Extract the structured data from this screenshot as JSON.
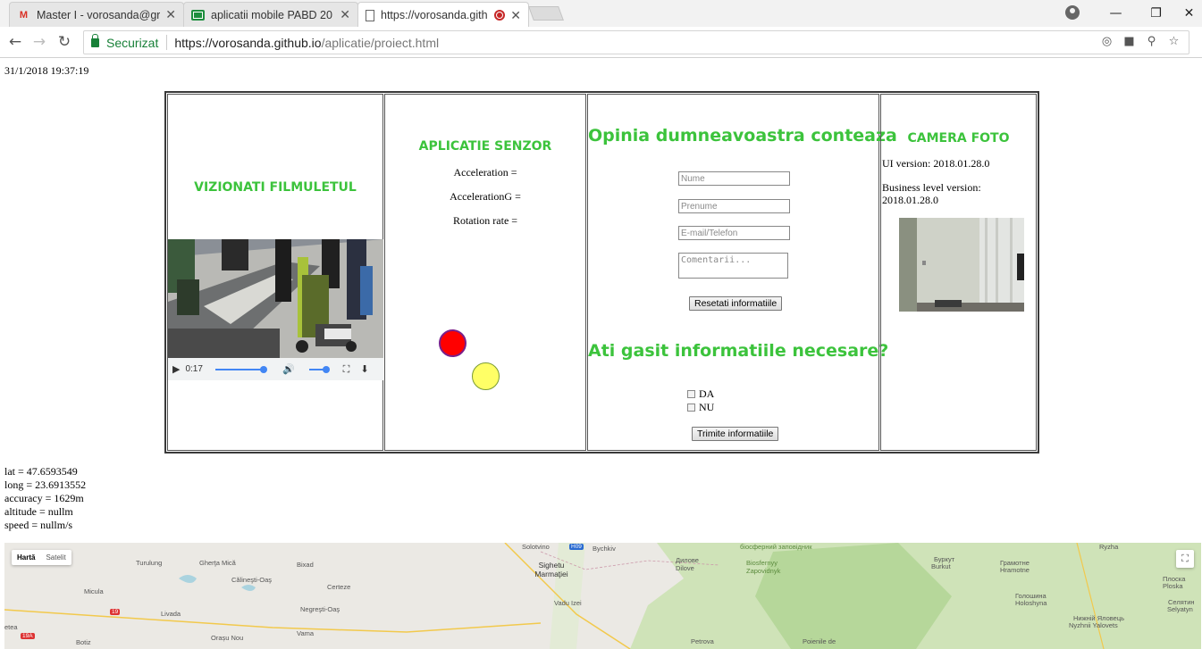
{
  "browser": {
    "tabs": [
      {
        "title": "Master I - vorosanda@gr",
        "icon": "gmail-icon"
      },
      {
        "title": "aplicatii mobile PABD 20",
        "icon": "sheets-icon"
      },
      {
        "title": "https://vorosanda.gith",
        "icon": "page-icon",
        "active": true
      }
    ],
    "close_glyph": "✕",
    "secure_label": "Securizat",
    "url_host": "https://vorosanda.github.io",
    "url_path": "/aplicatie/proiect.html"
  },
  "page": {
    "datetime": "31/1/2018 19:37:19",
    "video_section": {
      "title": "VIZIONATI FILMULETUL",
      "time": "0:17",
      "progress_fraction": 1.0,
      "volume_fraction": 0.85
    },
    "sensor_section": {
      "title": "APLICATIE SENZOR",
      "acceleration": "Acceleration =",
      "acceleration_g": "AccelerationG =",
      "rotation_rate": "Rotation rate ="
    },
    "feedback_section": {
      "title": "Opinia dumneavoastra conteaza",
      "name_placeholder": "Nume",
      "surname_placeholder": "Prenume",
      "contact_placeholder": "E-mail/Telefon",
      "comments_placeholder": "Comentarii...",
      "reset_label": "Resetati informatiile",
      "question": "Ati gasit informatiile necesare?",
      "yes_label": "DA",
      "no_label": "NU",
      "submit_label": "Trimite informatiile"
    },
    "camera_section": {
      "title": "CAMERA FOTO",
      "ui_version": "UI version: 2018.01.28.0",
      "business_version_label": "Business level version:",
      "business_version_value": "2018.01.28.0"
    },
    "geolocation": {
      "lat": "lat = 47.6593549",
      "long": "long = 23.6913552",
      "accuracy": "accuracy = 1629m",
      "altitude": "altitude = nullm",
      "speed": "speed = nullm/s"
    },
    "map": {
      "map_label": "Hartă",
      "satellite_label": "Satelit",
      "places": [
        "Turulung",
        "Gherţa Mică",
        "Bixad",
        "Micula",
        "Călineşti-Oaş",
        "Certeze",
        "Livada",
        "Negreşti-Oaş",
        "Botiz",
        "Orașu Nou",
        "Vama",
        "Solotvino",
        "Sighetu Marmaţiei",
        "Vadu Izei",
        "Bychkiv",
        "Dilove",
        "Biosfernyy Zapovidnyk",
        "Буркут",
        "Burkut",
        "Грамотне",
        "Hramotne",
        "Голошина",
        "Holoshyna",
        "Плоска",
        "Ploska",
        "Нижній Яловець",
        "Nyzhnii Yalovets",
        "Селятин",
        "Selyatyn",
        "Ryzha",
        "Petrova",
        "Poienile de",
        "etea",
        "Дилове",
        "біосферний заповідник"
      ],
      "road_badges": [
        "19",
        "19A",
        "H09"
      ]
    }
  },
  "colors": {
    "accent_green": "#3cc33c",
    "secure_green": "#188038",
    "ball_red": "#ff0000",
    "ball_yellow": "#ffff66"
  }
}
